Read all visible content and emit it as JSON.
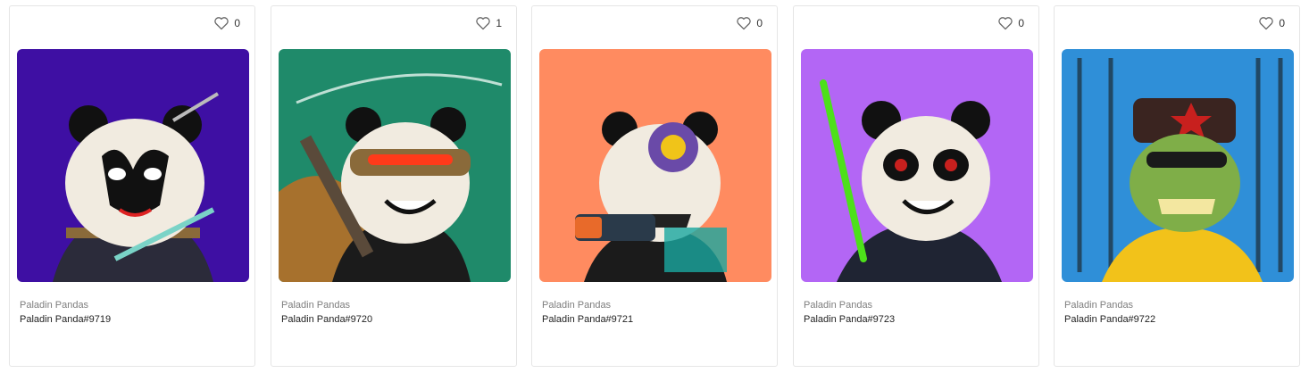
{
  "cards": [
    {
      "likes": "0",
      "collection": "Paladin Pandas",
      "name": "Paladin Panda#9719",
      "bg": "#3e0fa3",
      "accent": "#ffffff"
    },
    {
      "likes": "1",
      "collection": "Paladin Pandas",
      "name": "Paladin Panda#9720",
      "bg": "#1f8a6a",
      "accent": "#ff3a1a"
    },
    {
      "likes": "0",
      "collection": "Paladin Pandas",
      "name": "Paladin Panda#9721",
      "bg": "#ff8b60",
      "accent": "#f0c419"
    },
    {
      "likes": "0",
      "collection": "Paladin Pandas",
      "name": "Paladin Panda#9723",
      "bg": "#b366f5",
      "accent": "#4de01a"
    },
    {
      "likes": "0",
      "collection": "Paladin Pandas",
      "name": "Paladin Panda#9722",
      "bg": "#2f8fd8",
      "accent": "#c8201e"
    }
  ],
  "icons": {
    "like": "heart-outline-icon"
  }
}
